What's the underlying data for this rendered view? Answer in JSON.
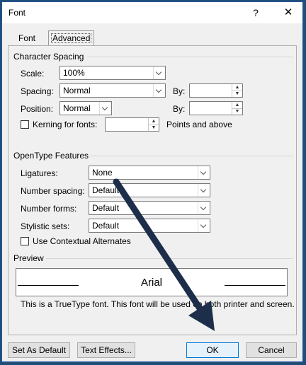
{
  "window": {
    "title": "Font",
    "help_icon": "help-question-icon",
    "close_icon": "close-icon"
  },
  "tabs": [
    {
      "label": "Font",
      "selected": false
    },
    {
      "label": "Advanced",
      "selected": true
    }
  ],
  "character_spacing": {
    "group_title": "Character Spacing",
    "scale": {
      "label": "Scale:",
      "value": "100%"
    },
    "spacing": {
      "label": "Spacing:",
      "value": "Normal",
      "by_label": "By:",
      "by_value": ""
    },
    "position": {
      "label": "Position:",
      "value": "Normal",
      "by_label": "By:",
      "by_value": ""
    },
    "kerning": {
      "label": "Kerning for fonts:",
      "value": "",
      "suffix": "Points and above",
      "checked": false
    }
  },
  "opentype": {
    "group_title": "OpenType Features",
    "ligatures": {
      "label": "Ligatures:",
      "value": "None"
    },
    "number_spacing": {
      "label": "Number spacing:",
      "value": "Default"
    },
    "number_forms": {
      "label": "Number forms:",
      "value": "Default"
    },
    "stylistic_sets": {
      "label": "Stylistic sets:",
      "value": "Default"
    },
    "contextual": {
      "label": "Use Contextual Alternates",
      "checked": false
    }
  },
  "preview": {
    "group_title": "Preview",
    "sample_text": "Arial",
    "description": "This is a TrueType font. This font will be used on both printer and screen."
  },
  "buttons": {
    "set_default": "Set As Default",
    "text_effects": "Text Effects...",
    "ok": "OK",
    "cancel": "Cancel"
  },
  "annotation": {
    "arrow_color": "#1c2e4a"
  }
}
